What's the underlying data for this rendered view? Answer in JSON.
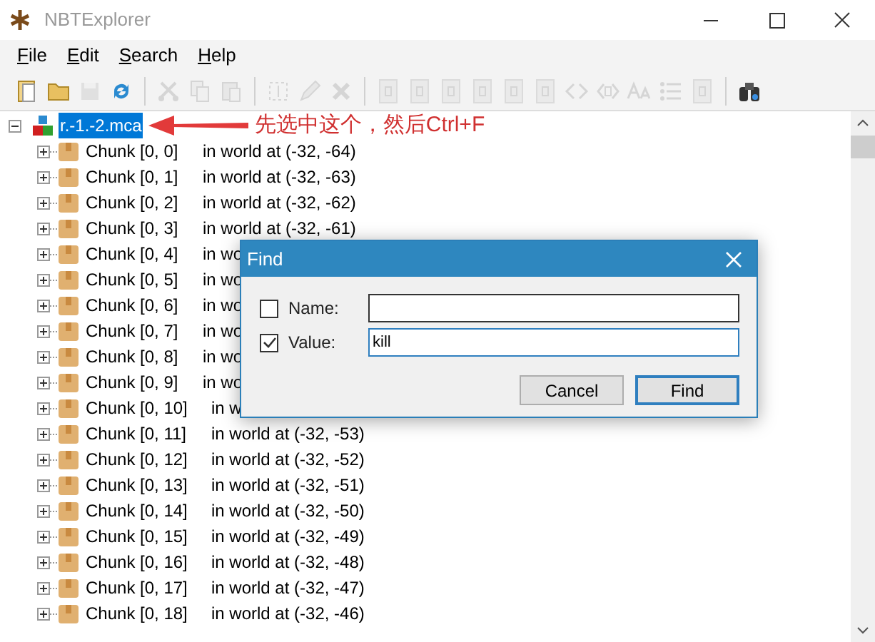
{
  "window": {
    "title": "NBTExplorer"
  },
  "menu": [
    {
      "label": "File"
    },
    {
      "label": "Edit"
    },
    {
      "label": "Search"
    },
    {
      "label": "Help"
    }
  ],
  "toolbar": [
    {
      "kind": "new",
      "disabled": false
    },
    {
      "kind": "open",
      "disabled": false
    },
    {
      "kind": "save",
      "disabled": true
    },
    {
      "kind": "refresh",
      "disabled": false
    },
    {
      "kind": "sep"
    },
    {
      "kind": "cut",
      "disabled": true
    },
    {
      "kind": "copy",
      "disabled": true
    },
    {
      "kind": "paste",
      "disabled": true
    },
    {
      "kind": "sep"
    },
    {
      "kind": "rename",
      "disabled": true
    },
    {
      "kind": "edit",
      "disabled": true
    },
    {
      "kind": "delete",
      "disabled": true
    },
    {
      "kind": "sep"
    },
    {
      "kind": "tag",
      "disabled": true
    },
    {
      "kind": "tag",
      "disabled": true
    },
    {
      "kind": "tag",
      "disabled": true
    },
    {
      "kind": "tag",
      "disabled": true
    },
    {
      "kind": "tag",
      "disabled": true
    },
    {
      "kind": "tag",
      "disabled": true
    },
    {
      "kind": "code",
      "disabled": true
    },
    {
      "kind": "code2",
      "disabled": true
    },
    {
      "kind": "text",
      "disabled": true
    },
    {
      "kind": "list",
      "disabled": true
    },
    {
      "kind": "tag",
      "disabled": true
    },
    {
      "kind": "sep"
    },
    {
      "kind": "find",
      "disabled": false
    }
  ],
  "tree": {
    "root": {
      "label": "r.-1.-2.mca",
      "selected": true,
      "expanded": true
    },
    "children": [
      {
        "name": "Chunk [0, 0]",
        "location": "in world at (-32, -64)"
      },
      {
        "name": "Chunk [0, 1]",
        "location": "in world at (-32, -63)"
      },
      {
        "name": "Chunk [0, 2]",
        "location": "in world at (-32, -62)"
      },
      {
        "name": "Chunk [0, 3]",
        "location": "in world at (-32, -61)"
      },
      {
        "name": "Chunk [0, 4]",
        "location": "in wo"
      },
      {
        "name": "Chunk [0, 5]",
        "location": "in wo"
      },
      {
        "name": "Chunk [0, 6]",
        "location": "in wo"
      },
      {
        "name": "Chunk [0, 7]",
        "location": "in wo"
      },
      {
        "name": "Chunk [0, 8]",
        "location": "in wo"
      },
      {
        "name": "Chunk [0, 9]",
        "location": "in wo"
      },
      {
        "name": "Chunk [0, 10]",
        "location": "in w"
      },
      {
        "name": "Chunk [0, 11]",
        "location": "in world at (-32, -53)"
      },
      {
        "name": "Chunk [0, 12]",
        "location": "in world at (-32, -52)"
      },
      {
        "name": "Chunk [0, 13]",
        "location": "in world at (-32, -51)"
      },
      {
        "name": "Chunk [0, 14]",
        "location": "in world at (-32, -50)"
      },
      {
        "name": "Chunk [0, 15]",
        "location": "in world at (-32, -49)"
      },
      {
        "name": "Chunk [0, 16]",
        "location": "in world at (-32, -48)"
      },
      {
        "name": "Chunk [0, 17]",
        "location": "in world at (-32, -47)"
      },
      {
        "name": "Chunk [0, 18]",
        "location": "in world at (-32, -46)"
      }
    ]
  },
  "annotation": {
    "text": "先选中这个，然后Ctrl+F"
  },
  "dialog": {
    "title": "Find",
    "fields": [
      {
        "label": "Name:",
        "checked": false,
        "focused": false
      },
      {
        "label": "Value:",
        "checked": true,
        "value": "kill",
        "focused": true
      }
    ],
    "buttons": [
      {
        "label": "Cancel",
        "default": false
      },
      {
        "label": "Find",
        "default": true
      }
    ]
  }
}
